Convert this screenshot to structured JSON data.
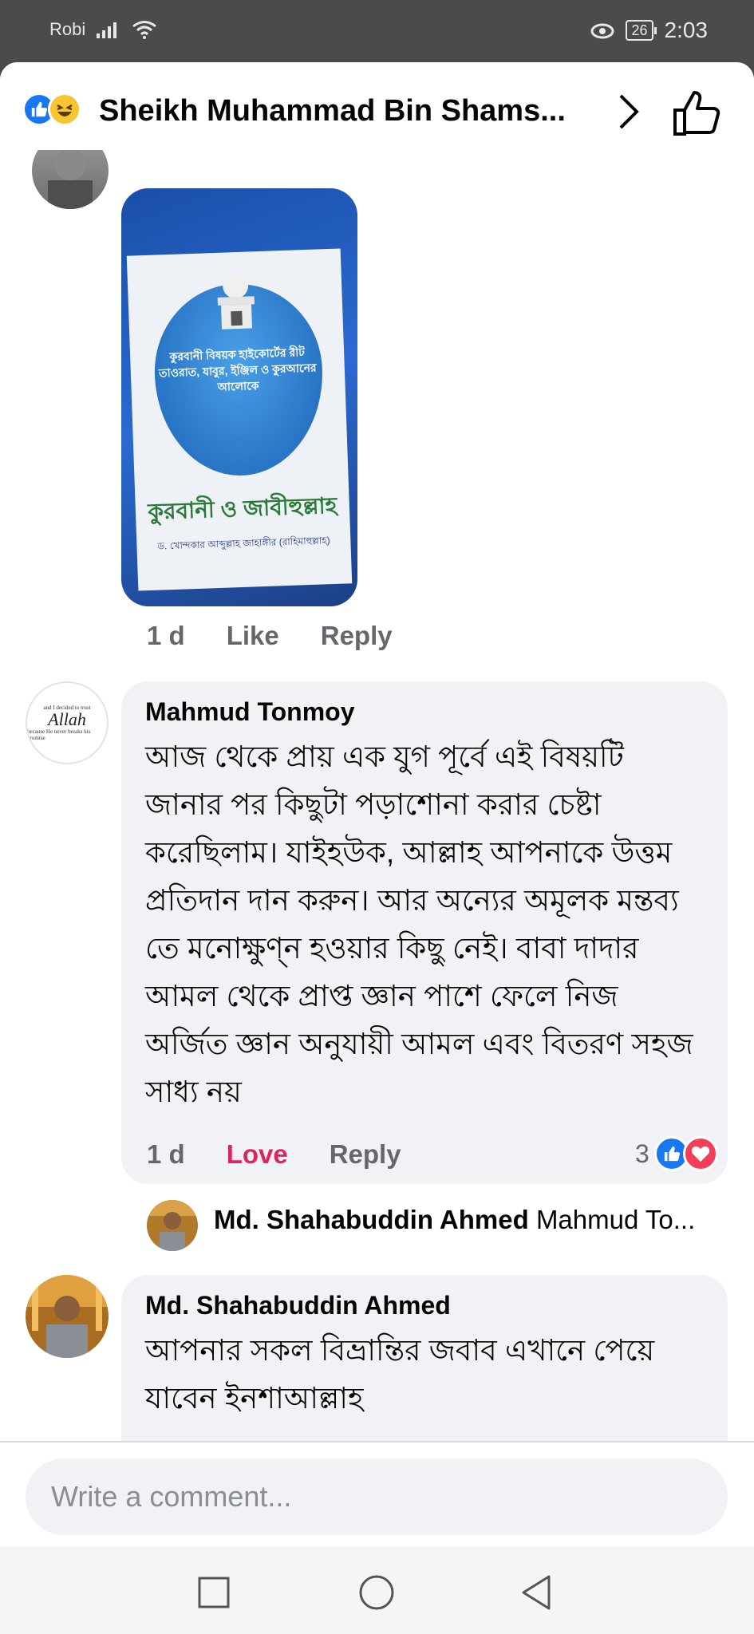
{
  "status_bar": {
    "carrier": "Robi",
    "battery": "26",
    "time": "2:03"
  },
  "header": {
    "title": "Sheikh Muhammad Bin Shams..."
  },
  "comments": {
    "first": {
      "image_alt": "Book cover",
      "book": {
        "subtitle": "কুরবানী বিষয়ক হাইকোর্টের রীট তাওরাত, যাবুর, ইঞ্জিল ও কুরআনের আলোকে",
        "title": "কুরবানী ও জাবীহুল্লাহ",
        "author": "ড. খোন্দকার আব্দুল্লাহ জাহাঙ্গীর (রাহিমাহুল্লাহ)"
      },
      "time": "1 d",
      "like_label": "Like",
      "reply_label": "Reply"
    },
    "second": {
      "avatar_small": "and I decided to trust",
      "avatar_big": "Allah",
      "avatar_small2": "because He never breaks his promise",
      "author": "Mahmud Tonmoy",
      "text": "আজ থেকে প্রায় এক যুগ পূর্বে এই বিষয়টি জানার পর কিছুটা পড়াশোনা করার চেষ্টা করেছিলাম। যাইহউক, আল্লাহ আপনাকে উত্তম প্রতিদান দান করুন। আর অন্যের অমূলক মন্তব্য তে মনোক্ষুণ্ন হওয়ার কিছু নেই। বাবা দাদার আমল থেকে প্রাপ্ত জ্ঞান পাশে ফেলে নিজ অর্জিত জ্ঞান অনুযায়ী আমল এবং বিতরণ সহজ সাধ্য নয়",
      "time": "1 d",
      "love_label": "Love",
      "reply_label": "Reply",
      "reaction_count": "3",
      "reply_preview_author": "Md. Shahabuddin Ahmed",
      "reply_preview_text": "Mahmud To..."
    },
    "third": {
      "author": "Md. Shahabuddin Ahmed",
      "text": "আপনার সকল বিভ্রান্তির জবাব এখানে পেয়ে যাবেন ইনশাআল্লাহ"
    }
  },
  "composer": {
    "placeholder": "Write a comment..."
  },
  "colors": {
    "like_blue": "#1877f2",
    "love_red": "#f33e58",
    "bubble_bg": "#f0f2f5"
  }
}
